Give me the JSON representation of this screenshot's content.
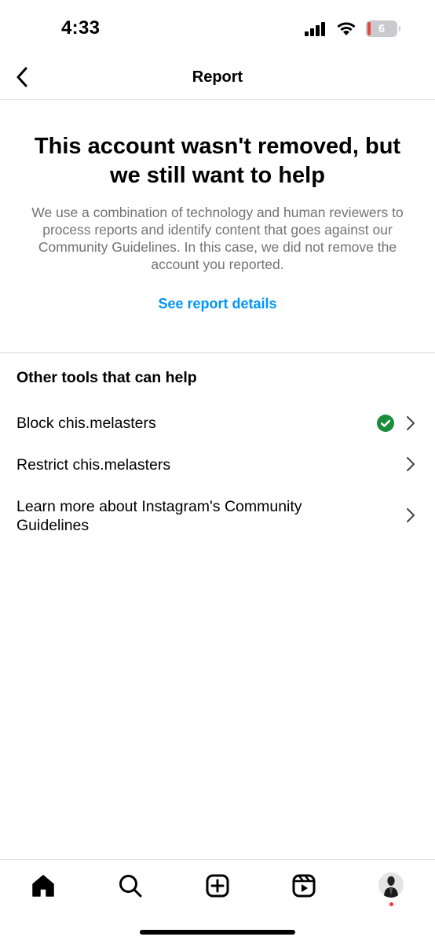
{
  "status_bar": {
    "time": "4:33",
    "battery_level": "6"
  },
  "nav": {
    "title": "Report"
  },
  "main": {
    "headline": "This account wasn't removed, but we still want to help",
    "description": "We use a combination of technology and human reviewers to process reports and identify content that goes against our Community Guidelines. In this case, we did not remove the account you reported.",
    "report_link": "See report details"
  },
  "tools": {
    "section_title": "Other tools that can help",
    "items": [
      {
        "label": "Block chis.melasters",
        "checked": true
      },
      {
        "label": "Restrict chis.melasters",
        "checked": false
      },
      {
        "label": "Learn more about Instagram's Community Guidelines",
        "checked": false
      }
    ]
  },
  "tab_bar": {
    "tabs": [
      "home-icon",
      "search-icon",
      "create-icon",
      "reels-icon",
      "profile-avatar"
    ],
    "notification_dot_color": "#ff3040"
  },
  "colors": {
    "link": "#0095f6",
    "check": "#1a8d3c",
    "battery_low": "#e5473d",
    "muted_text": "#737373"
  }
}
